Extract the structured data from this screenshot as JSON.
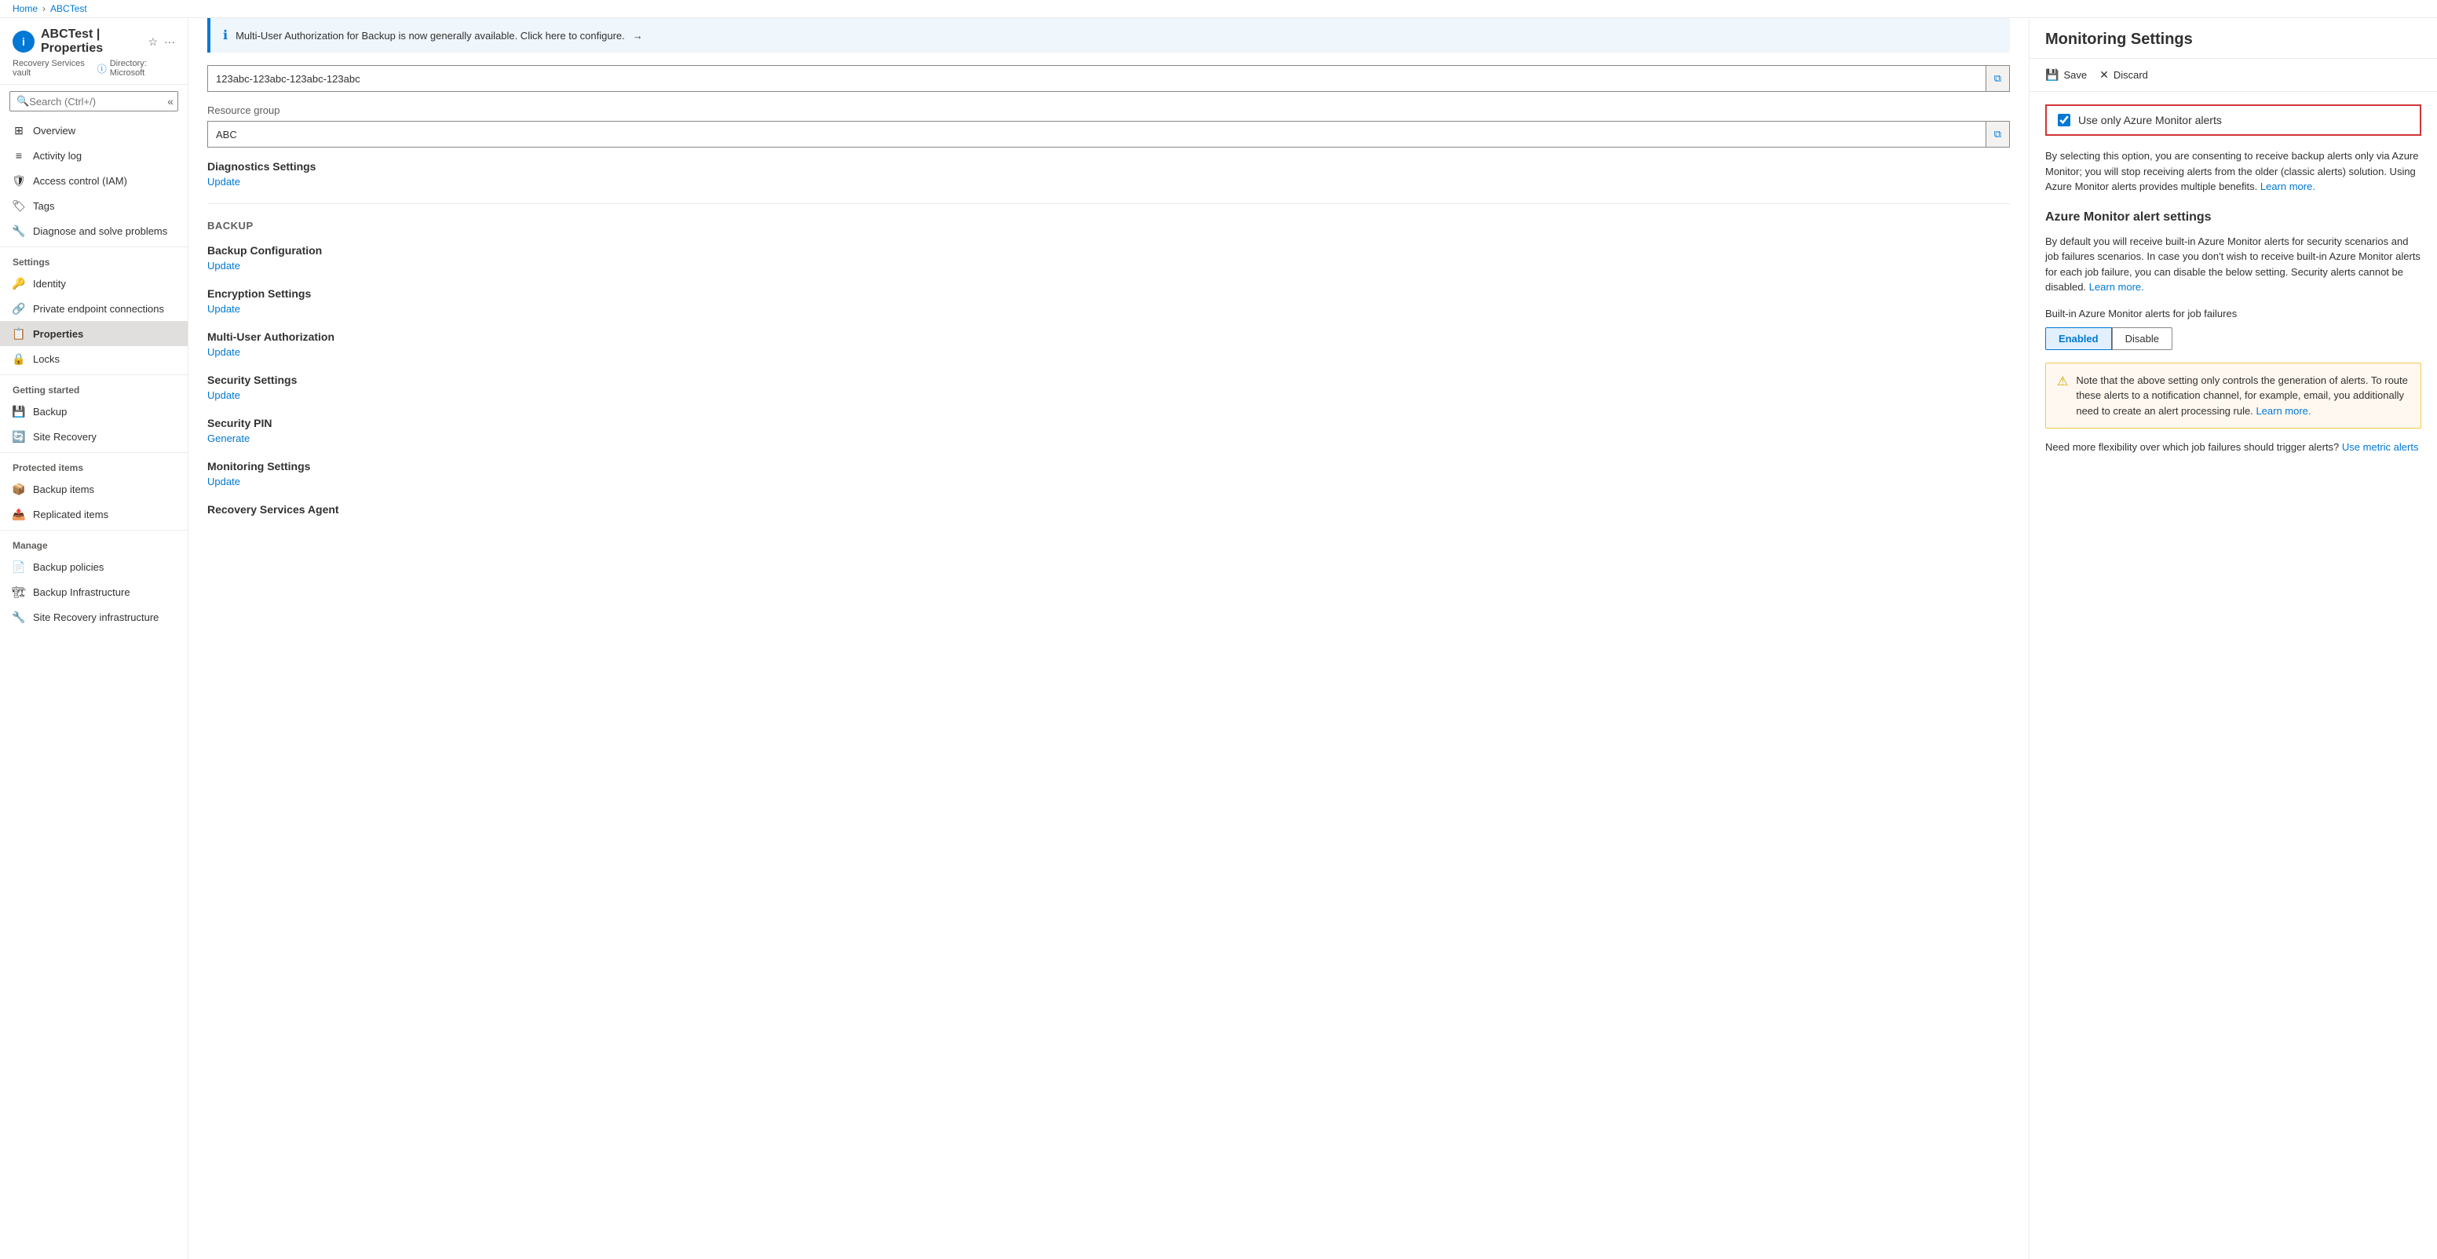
{
  "breadcrumb": {
    "home": "Home",
    "current": "ABCTest"
  },
  "sidebar": {
    "icon_letter": "i",
    "title": "ABCTest | Properties",
    "subtitle": "Recovery Services vault",
    "directory": "Directory: Microsoft",
    "search_placeholder": "Search (Ctrl+/)",
    "nav_items": [
      {
        "id": "overview",
        "label": "Overview",
        "icon": "grid"
      },
      {
        "id": "activity-log",
        "label": "Activity log",
        "icon": "list"
      },
      {
        "id": "access-control",
        "label": "Access control (IAM)",
        "icon": "shield"
      },
      {
        "id": "tags",
        "label": "Tags",
        "icon": "tag"
      },
      {
        "id": "diagnose",
        "label": "Diagnose and solve problems",
        "icon": "wrench"
      }
    ],
    "settings_section": "Settings",
    "settings_items": [
      {
        "id": "identity",
        "label": "Identity",
        "icon": "key"
      },
      {
        "id": "private-endpoint",
        "label": "Private endpoint connections",
        "icon": "link"
      },
      {
        "id": "properties",
        "label": "Properties",
        "icon": "properties",
        "active": true
      },
      {
        "id": "locks",
        "label": "Locks",
        "icon": "lock"
      }
    ],
    "getting_started_section": "Getting started",
    "getting_started_items": [
      {
        "id": "backup",
        "label": "Backup",
        "icon": "backup"
      },
      {
        "id": "site-recovery",
        "label": "Site Recovery",
        "icon": "site-recovery"
      }
    ],
    "protected_items_section": "Protected items",
    "protected_items": [
      {
        "id": "backup-items",
        "label": "Backup items",
        "icon": "backup-items"
      },
      {
        "id": "replicated-items",
        "label": "Replicated items",
        "icon": "replicated-items"
      }
    ],
    "manage_section": "Manage",
    "manage_items": [
      {
        "id": "backup-policies",
        "label": "Backup policies",
        "icon": "policies"
      },
      {
        "id": "backup-infrastructure",
        "label": "Backup Infrastructure",
        "icon": "infrastructure"
      },
      {
        "id": "site-recovery-infrastructure",
        "label": "Site Recovery infrastructure",
        "icon": "site-recovery-infra"
      }
    ]
  },
  "main": {
    "banner_text": "Multi-User Authorization for Backup is now generally available. Click here to configure.",
    "banner_arrow": "→",
    "resource_id_label": "",
    "resource_id_value": "123abc-123abc-123abc-123abc",
    "resource_group_label": "Resource group",
    "resource_group_value": "ABC",
    "diagnostics_section": "Diagnostics Settings",
    "diagnostics_update": "Update",
    "backup_section": "BACKUP",
    "backup_configuration_title": "Backup Configuration",
    "backup_configuration_update": "Update",
    "encryption_settings_title": "Encryption Settings",
    "encryption_settings_update": "Update",
    "multi_user_auth_title": "Multi-User Authorization",
    "multi_user_auth_update": "Update",
    "security_settings_title": "Security Settings",
    "security_settings_update": "Update",
    "security_pin_title": "Security PIN",
    "security_pin_generate": "Generate",
    "monitoring_settings_title": "Monitoring Settings",
    "monitoring_settings_update": "Update",
    "recovery_services_agent_title": "Recovery Services Agent"
  },
  "monitoring_panel": {
    "title": "Monitoring Settings",
    "save_label": "Save",
    "discard_label": "Discard",
    "checkbox_label": "Use only Azure Monitor alerts",
    "checkbox_checked": true,
    "description": "By selecting this option, you are consenting to receive backup alerts only via Azure Monitor; you will stop receiving alerts from the older (classic alerts) solution. Using Azure Monitor alerts provides multiple benefits.",
    "description_learn_more": "Learn more.",
    "azure_monitor_section_title": "Azure Monitor alert settings",
    "alert_settings_description": "By default you will receive built-in Azure Monitor alerts for security scenarios and job failures scenarios. In case you don't wish to receive built-in Azure Monitor alerts for each job failure, you can disable the below setting. Security alerts cannot be disabled.",
    "alert_settings_learn_more": "Learn more.",
    "built_in_label": "Built-in Azure Monitor alerts for job failures",
    "toggle_enabled": "Enabled",
    "toggle_disable": "Disable",
    "warning_text": "Note that the above setting only controls the generation of alerts. To route these alerts to a notification channel, for example, email, you additionally need to create an alert processing rule.",
    "warning_learn_more": "Learn more.",
    "flexibility_text": "Need more flexibility over which job failures should trigger alerts?",
    "flexibility_link": "Use metric alerts"
  }
}
